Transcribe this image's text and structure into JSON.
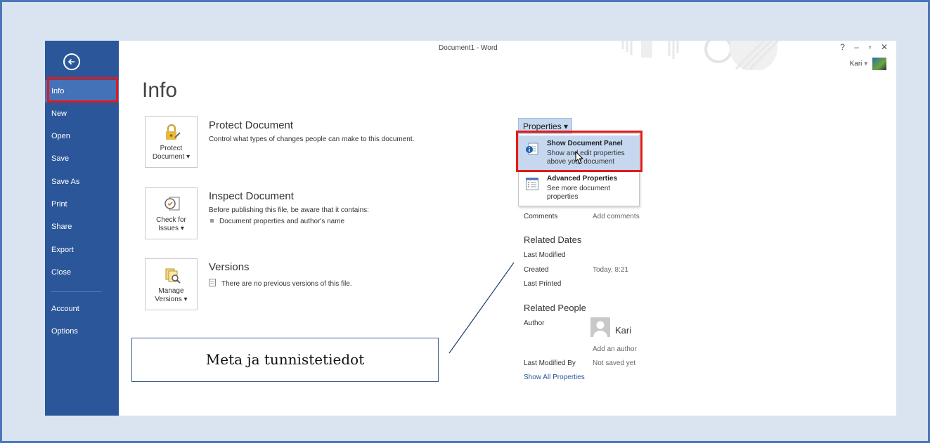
{
  "window": {
    "title": "Document1 - Word",
    "controls": {
      "help": "?",
      "minimize": "–",
      "restore": "▫",
      "close": "✕"
    },
    "user_name": "Kari",
    "user_caret": "▾"
  },
  "sidebar": {
    "items": [
      {
        "label": "Info",
        "active": true
      },
      {
        "label": "New"
      },
      {
        "label": "Open"
      },
      {
        "label": "Save"
      },
      {
        "label": "Save As"
      },
      {
        "label": "Print"
      },
      {
        "label": "Share"
      },
      {
        "label": "Export"
      },
      {
        "label": "Close"
      },
      {
        "label": "Account"
      },
      {
        "label": "Options"
      }
    ]
  },
  "main": {
    "title": "Info",
    "sections": [
      {
        "button_line1": "Protect",
        "button_line2": "Document ▾",
        "title": "Protect Document",
        "desc": "Control what types of changes people can make to this document.",
        "icon": "lock-icon"
      },
      {
        "button_line1": "Check for",
        "button_line2": "Issues ▾",
        "title": "Inspect Document",
        "desc": "Before publishing this file, be aware that it contains:",
        "bullet": "Document properties and author's name",
        "icon": "inspect-icon"
      },
      {
        "button_line1": "Manage",
        "button_line2": "Versions ▾",
        "title": "Versions",
        "desc": "There are no previous versions of this file.",
        "icon": "versions-icon"
      }
    ]
  },
  "properties": {
    "button_label": "Properties ▾",
    "menu": [
      {
        "title": "Show Document Panel",
        "desc1": "Show and edit properties",
        "desc2": "above your document",
        "icon": "info-panel-icon"
      },
      {
        "title": "Advanced Properties",
        "desc1": "See more document",
        "desc2": "properties",
        "icon": "list-icon"
      }
    ],
    "comments_label": "Comments",
    "comments_value": "Add comments",
    "related_dates": {
      "heading": "Related Dates",
      "last_modified": "Last Modified",
      "created": "Created",
      "created_value": "Today, 8:21",
      "last_printed": "Last Printed"
    },
    "related_people": {
      "heading": "Related People",
      "author": "Author",
      "author_name": "Kari",
      "add_author": "Add an author",
      "last_modified_by": "Last Modified By",
      "last_modified_by_value": "Not saved yet"
    },
    "show_all": "Show All Properties"
  },
  "callout": {
    "text": "Meta ja tunnistetiedot"
  },
  "colors": {
    "sidebar": "#2b579a",
    "highlight": "#e21a1a",
    "accent": "#c5d8ef"
  }
}
